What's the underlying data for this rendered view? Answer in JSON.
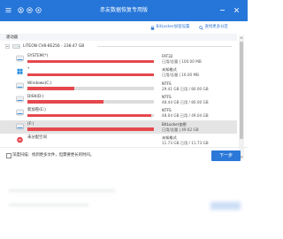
{
  "window": {
    "title": "赤友数据恢复专用版"
  },
  "toolbar": {
    "bitlocker_label": "BitLocker加密设置",
    "find_label": "查找更多分区"
  },
  "drives": {
    "section_label": "驱动器",
    "disk": {
      "label": "LITEON CV8-8E256 - 238.47 GB",
      "icon": "disk-icon"
    },
    "partitions": [
      {
        "name": "SYSTEM(*)",
        "fs": "FAT32",
        "size": "已用/总量 | 100.00 MB",
        "used_fraction": 1.0,
        "icon": "drive-icon"
      },
      {
        "name": "*",
        "fs": "未知格式",
        "size": "已用/总量 | 16.00 MB",
        "used_fraction": 1.0,
        "icon": "windows-logo-icon"
      },
      {
        "name": "Windows(C:)",
        "fs": "NTFS",
        "size": "29.41 GB 已用 / 80.00 GB",
        "used_fraction": 0.37,
        "icon": "drive-icon"
      },
      {
        "name": "DISK(D:)",
        "fs": "NTFS",
        "size": "48.44 GB 已用 / 80.00 GB",
        "used_fraction": 0.6,
        "icon": "drive-icon"
      },
      {
        "name": "新加卷(E:)",
        "fs": "NTFS",
        "size": "48.04 GB 已用 / 49.04 GB",
        "used_fraction": 0.98,
        "icon": "drive-icon"
      },
      {
        "name": "(F:)",
        "fs": "BitLocker加密",
        "size": "已用/总量 | 49.62 GB",
        "used_fraction": 1.0,
        "icon": "drive-icon",
        "selected": true
      },
      {
        "name": "未分配空间",
        "fs": "未知格式",
        "size": "11.73 GB 已用 / 11.73 GB",
        "used_fraction": null,
        "icon": "unallocated-icon"
      }
    ]
  },
  "footer": {
    "deep_scan_label": "深度扫描：找到更多文件，但需要更长的时间。",
    "deep_scan_checked": false,
    "next_label": "下一步"
  },
  "colors": {
    "accent": "#2b78d8",
    "titlebar": "#2676d9",
    "bar_used": "#e5484d",
    "bar_free": "#dcdcdc",
    "selected_row": "#e4e4e4"
  }
}
